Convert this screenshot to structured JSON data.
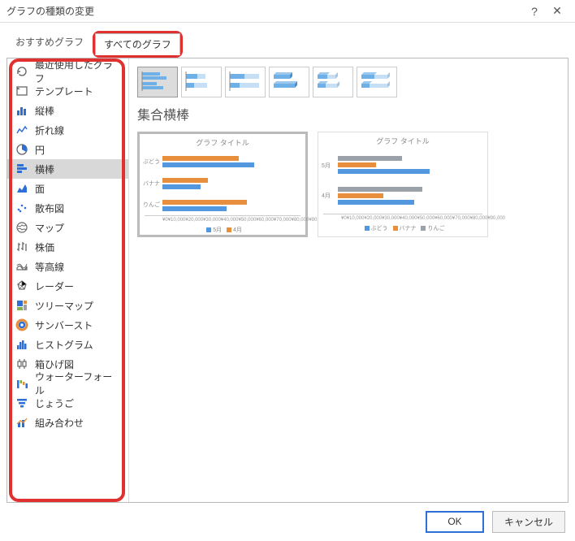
{
  "dialog": {
    "title": "グラフの種類の変更",
    "help": "?",
    "close": "✕"
  },
  "tabs": {
    "recommended": "おすすめグラフ",
    "all": "すべてのグラフ"
  },
  "sidebar": {
    "items": [
      {
        "label": "最近使用したグラフ"
      },
      {
        "label": "テンプレート"
      },
      {
        "label": "縦棒"
      },
      {
        "label": "折れ線"
      },
      {
        "label": "円"
      },
      {
        "label": "横棒"
      },
      {
        "label": "面"
      },
      {
        "label": "散布図"
      },
      {
        "label": "マップ"
      },
      {
        "label": "株価"
      },
      {
        "label": "等高線"
      },
      {
        "label": "レーダー"
      },
      {
        "label": "ツリーマップ"
      },
      {
        "label": "サンバースト"
      },
      {
        "label": "ヒストグラム"
      },
      {
        "label": "箱ひげ図"
      },
      {
        "label": "ウォーターフォール"
      },
      {
        "label": "じょうご"
      },
      {
        "label": "組み合わせ"
      }
    ]
  },
  "subtype": {
    "title": "集合横棒"
  },
  "preview1": {
    "title": "グラフ タイトル",
    "chart_data": {
      "type": "bar",
      "orientation": "horizontal",
      "categories": [
        "ぶどう",
        "バナナ",
        "りんご"
      ],
      "series": [
        {
          "name": "5月",
          "color": "#5397df",
          "values": [
            60000,
            25000,
            42000
          ]
        },
        {
          "name": "4月",
          "color": "#e88f3e",
          "values": [
            50000,
            30000,
            55000
          ]
        }
      ],
      "xlabel": "",
      "ylabel": "",
      "xlim": [
        0,
        90000
      ],
      "xticks": [
        "¥0",
        "¥10,000",
        "¥20,000",
        "¥30,000",
        "¥40,000",
        "¥50,000",
        "¥60,000",
        "¥70,000",
        "¥80,000",
        "¥90,000"
      ]
    },
    "legend": [
      "5月",
      "4月"
    ]
  },
  "preview2": {
    "title": "グラフ タイトル",
    "chart_data": {
      "type": "bar",
      "orientation": "horizontal",
      "categories": [
        "5月",
        "4月"
      ],
      "series": [
        {
          "name": "ぶどう",
          "color": "#5397df",
          "values": [
            60000,
            50000
          ]
        },
        {
          "name": "バナナ",
          "color": "#e88f3e",
          "values": [
            25000,
            30000
          ]
        },
        {
          "name": "りんご",
          "color": "#9aa1a8",
          "values": [
            42000,
            55000
          ]
        }
      ],
      "xlabel": "",
      "ylabel": "",
      "xlim": [
        0,
        90000
      ],
      "xticks": [
        "¥0",
        "¥10,000",
        "¥20,000",
        "¥30,000",
        "¥40,000",
        "¥50,000",
        "¥60,000",
        "¥70,000",
        "¥80,000",
        "¥90,000"
      ]
    },
    "legend": [
      "ぶどう",
      "バナナ",
      "りんご"
    ]
  },
  "footer": {
    "ok": "OK",
    "cancel": "キャンセル"
  }
}
